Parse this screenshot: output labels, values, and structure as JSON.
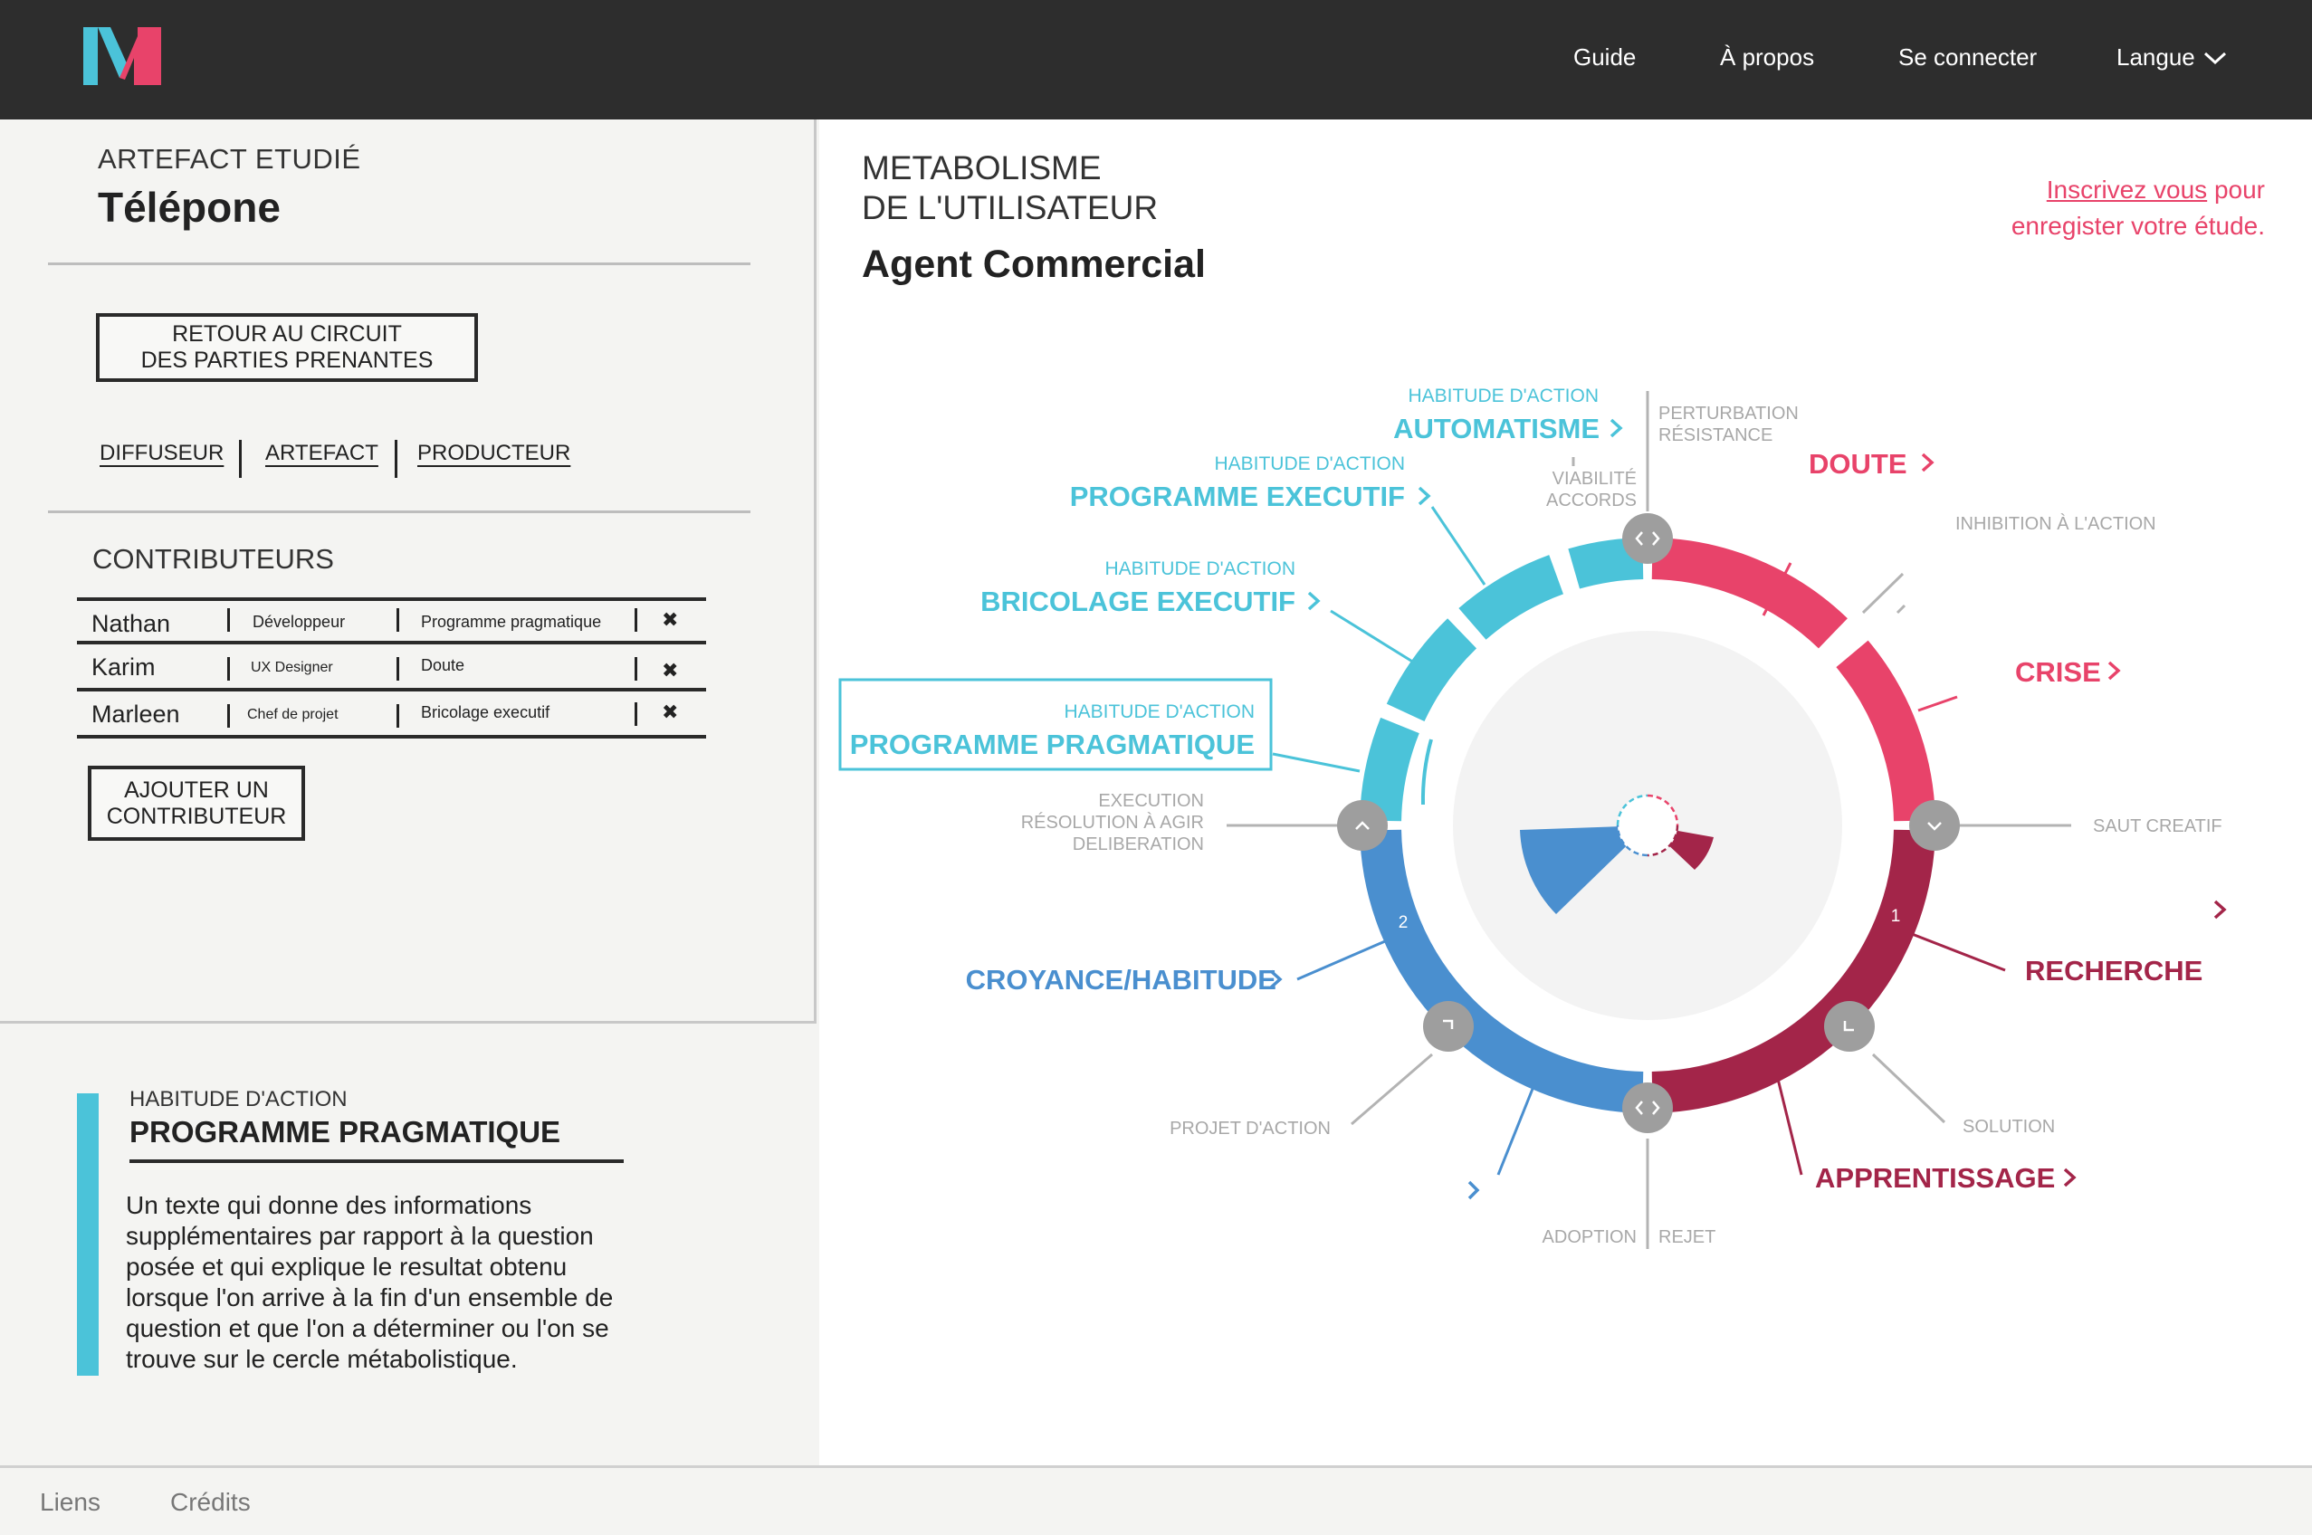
{
  "nav": {
    "logo_letter": "M",
    "guide": "Guide",
    "apropos": "À propos",
    "login": "Se connecter",
    "langue": "Langue"
  },
  "artifact": {
    "kicker": "ARTEFACT ETUDIÉ",
    "name": "Télépone"
  },
  "back_button": {
    "line1": "RETOUR AU CIRCUIT",
    "line2": "DES PARTIES PRENANTES"
  },
  "tabs": [
    "DIFFUSEUR",
    "ARTEFACT",
    "PRODUCTEUR"
  ],
  "contributors": {
    "title": "CONTRIBUTEURS",
    "rows": [
      {
        "name": "Nathan",
        "role": "Développeur",
        "habit": "Programme pragmatique",
        "del": "✖"
      },
      {
        "name": "Karim",
        "role": "UX Designer",
        "habit": "Doute",
        "del": "✖"
      },
      {
        "name": "Marleen",
        "role": "Chef de projet",
        "habit": "Bricolage executif",
        "del": "✖"
      }
    ],
    "add_line1": "AJOUTER UN",
    "add_line2": "CONTRIBUTEUR"
  },
  "info": {
    "kicker": "HABITUDE D'ACTION",
    "title": "PROGRAMME PRAGMATIQUE",
    "lines": [
      "Un texte qui donne des informations",
      "supplémentaires par rapport à la question",
      "posée et qui explique le resultat obtenu",
      "lorsque l'on arrive à la fin d'un ensemble de",
      "question et que l'on a déterminer ou l'on se",
      "trouve sur le cercle métabolistique."
    ],
    "accent": "#4bc3d9"
  },
  "metabolism": {
    "kicker_line1": "METABOLISME",
    "kicker_line2": "DE L'UTILISATEUR",
    "role": "Agent Commercial",
    "signup_link": "Inscrivez vous",
    "signup_rest1": " pour",
    "signup_rest2": "enregister votre étude."
  },
  "wheel": {
    "colors": {
      "cyan": "#4bc3d9",
      "blue": "#4a8fcf",
      "pink": "#e8436a",
      "crimson": "#a32549",
      "grey": "#b3b3b3",
      "node": "#9e9e9e"
    },
    "labels": {
      "automatisme_kicker": "HABITUDE D'ACTION",
      "automatisme": "AUTOMATISME",
      "programme_exec_kicker": "HABITUDE D'ACTION",
      "programme_exec": "PROGRAMME EXECUTIF",
      "bricolage_kicker": "HABITUDE D'ACTION",
      "bricolage": "BRICOLAGE EXECUTIF",
      "pragmatique_kicker": "HABITUDE D'ACTION",
      "pragmatique": "PROGRAMME PRAGMATIQUE",
      "croyance": "CROYANCE/HABITUDE",
      "doute": "DOUTE",
      "crise": "CRISE",
      "recherche": "RECHERCHE",
      "apprentissage": "APPRENTISSAGE",
      "perturbation": "PERTURBATION",
      "resistance": "RÉSISTANCE",
      "viabilite": "VIABILITÉ",
      "accords": "ACCORDS",
      "inhibition": "INHIBITION À L'ACTION",
      "saut": "SAUT CREATIF",
      "solution": "SOLUTION",
      "adoption": "ADOPTION",
      "rejet": "REJET",
      "projet": "PROJET D'ACTION",
      "execution": "EXECUTION",
      "resolution": "RÉSOLUTION À AGIR",
      "deliberation": "DELIBERATION",
      "num1": "1",
      "num2": "2",
      "chevron": "›"
    }
  },
  "footer": {
    "liens": "Liens",
    "credits": "Crédits"
  }
}
